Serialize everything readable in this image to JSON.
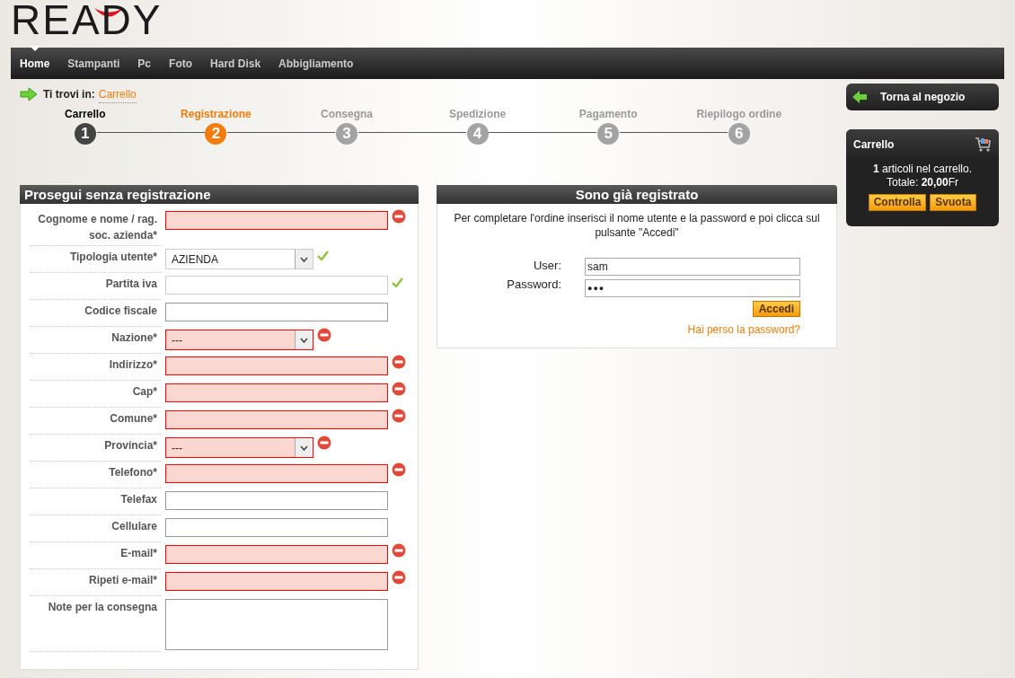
{
  "logo": {
    "text": "READY"
  },
  "nav": [
    {
      "label": "Home",
      "selected": true
    },
    {
      "label": "Stampanti",
      "selected": false
    },
    {
      "label": "Pc",
      "selected": false
    },
    {
      "label": "Foto",
      "selected": false
    },
    {
      "label": "Hard Disk",
      "selected": false
    },
    {
      "label": "Abbigliamento",
      "selected": false
    }
  ],
  "breadcrumb": {
    "prefix": "Ti trovi in:",
    "link": "Carrello"
  },
  "steps": [
    {
      "label": "Carrello",
      "number": "1",
      "completed": true,
      "selected": false
    },
    {
      "label": "Registrazione",
      "number": "2",
      "completed": false,
      "selected": true
    },
    {
      "label": "Consegna",
      "number": "3",
      "completed": false,
      "selected": false
    },
    {
      "label": "Spedizione",
      "number": "4",
      "completed": false,
      "selected": false
    },
    {
      "label": "Pagamento",
      "number": "5",
      "completed": false,
      "selected": false
    },
    {
      "label": "Riepilogo ordine",
      "number": "6",
      "completed": false,
      "selected": false
    }
  ],
  "guest_form": {
    "title": "Prosegui senza registrazione",
    "fields": [
      {
        "label": "Cognome e nome / rag. soc. azienda*",
        "kind": "text",
        "invalid": true,
        "valid": false
      },
      {
        "label": "Tipologia utente*",
        "kind": "select",
        "value": "AZIENDA",
        "invalid": false,
        "valid": true
      },
      {
        "label": "Partita iva",
        "kind": "text",
        "invalid": false,
        "valid": true
      },
      {
        "label": "Codice fiscale",
        "kind": "text",
        "invalid": false,
        "valid": false
      },
      {
        "label": "Nazione*",
        "kind": "select",
        "value": "---",
        "invalid": true,
        "valid": false
      },
      {
        "label": "Indirizzo*",
        "kind": "text",
        "invalid": true,
        "valid": false
      },
      {
        "label": "Cap*",
        "kind": "text",
        "invalid": true,
        "valid": false
      },
      {
        "label": "Comune*",
        "kind": "text",
        "invalid": true,
        "valid": false
      },
      {
        "label": "Provincia*",
        "kind": "select",
        "value": "---",
        "invalid": true,
        "valid": false
      },
      {
        "label": "Telefono*",
        "kind": "text",
        "invalid": true,
        "valid": false
      },
      {
        "label": "Telefax",
        "kind": "text",
        "invalid": false,
        "valid": false
      },
      {
        "label": "Cellulare",
        "kind": "text",
        "invalid": false,
        "valid": false
      },
      {
        "label": "E-mail*",
        "kind": "text",
        "invalid": true,
        "valid": false
      },
      {
        "label": "Ripeti e-mail*",
        "kind": "text",
        "invalid": true,
        "valid": false
      },
      {
        "label": "Note per la consegna",
        "kind": "textarea",
        "invalid": false,
        "valid": false
      }
    ]
  },
  "login": {
    "title": "Sono già registrato",
    "intro": "Per completare l'ordine inserisci il nome utente e la password e poi clicca sul pulsante \"Accedi\"",
    "user_label": "User:",
    "user_value": "sam",
    "password_label": "Password:",
    "password_value": "●●●",
    "submit": "Accedi",
    "lost_password": "Hai perso la password?"
  },
  "back_button": "Torna al negozio",
  "cart": {
    "title": "Carrello",
    "summary": "**1** articoli nel carrello.",
    "total": "Totale: **20,00**Fr",
    "buttons": [
      "Controlla",
      "Svuota"
    ]
  }
}
